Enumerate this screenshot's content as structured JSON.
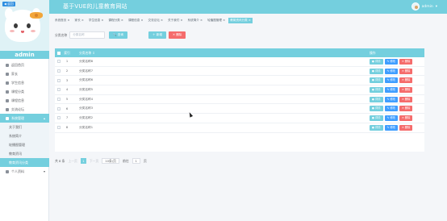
{
  "header": {
    "title": "基于VUE的儿童教育网站",
    "user": "admin",
    "user_caret": "▾"
  },
  "sidebar": {
    "back_label": "◀ 返回",
    "username": "admin",
    "items": [
      {
        "label": "返回首页",
        "icon": "home-icon"
      },
      {
        "label": "家长",
        "icon": "parent-icon"
      },
      {
        "label": "学生信息",
        "icon": "student-icon"
      },
      {
        "label": "课程分类",
        "icon": "category-icon"
      },
      {
        "label": "课程信息",
        "icon": "course-icon"
      },
      {
        "label": "交流论坛",
        "icon": "forum-icon"
      },
      {
        "label": "系统管理",
        "icon": "system-icon",
        "active": true
      }
    ],
    "subitems": [
      "关于我们",
      "系统简介",
      "轮播图管理",
      "教育资讯",
      "教育资讯分类"
    ],
    "bottom_item": "个人资料"
  },
  "tabs": [
    "系统首页 ×",
    "家长 ×",
    "学生信息 ×",
    "课程分类 ×",
    "课程信息 ×",
    "交流论坛 ×",
    "关于我们 ×",
    "系统简介 ×",
    "轮播图管理 ×",
    "教育资讯分类 ×"
  ],
  "search": {
    "label": "分类名称",
    "placeholder": "分类名称",
    "button": "🔍 查询"
  },
  "actions": {
    "add": "＋ 新增",
    "delete": "✕ 删除"
  },
  "table": {
    "headers": {
      "index": "索引",
      "name": "分类名称 ↕",
      "ops": "操作"
    },
    "rows": [
      {
        "index": "1",
        "name": "分类名称8"
      },
      {
        "index": "2",
        "name": "分类名称7"
      },
      {
        "index": "3",
        "name": "分类名称6"
      },
      {
        "index": "4",
        "name": "分类名称5"
      },
      {
        "index": "5",
        "name": "分类名称4"
      },
      {
        "index": "6",
        "name": "分类名称3"
      },
      {
        "index": "7",
        "name": "分类名称2"
      },
      {
        "index": "8",
        "name": "分类名称1"
      }
    ],
    "op_labels": {
      "detail": "● 详情",
      "edit": "✎ 修改",
      "del": "✕ 删除"
    }
  },
  "pagination": {
    "total": "共 8 条",
    "prev": "上一页",
    "current": "1",
    "next": "下一页",
    "page_size": "10条/页",
    "goto": "前往",
    "goto_value": "1",
    "page_unit": "页"
  },
  "colors": {
    "primary": "#74cfde",
    "danger": "#f56c6c",
    "edit": "#409eff"
  }
}
